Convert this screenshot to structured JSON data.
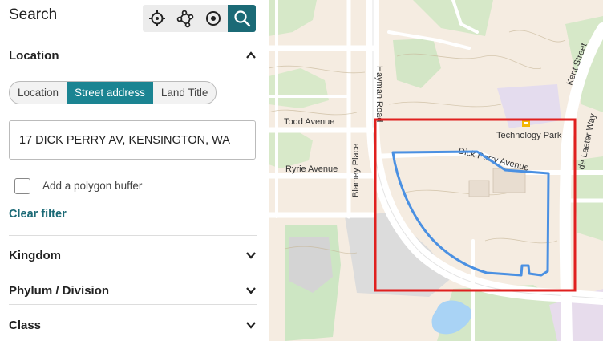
{
  "panel": {
    "title": "Search",
    "toolbar": {
      "icons": [
        "crosshair-icon",
        "polygon-draw-icon",
        "radius-icon",
        "search-icon"
      ],
      "active": "search-icon",
      "accent_color": "#1b6a76"
    },
    "location_section": {
      "label": "Location",
      "expanded": true,
      "tabs": [
        "Location",
        "Street address",
        "Land Title"
      ],
      "selected_tab": "Street address",
      "address_value": "17 DICK PERRY AV, KENSINGTON, WA",
      "buffer_label": "Add a polygon buffer",
      "buffer_checked": false,
      "clear_label": "Clear filter"
    },
    "sections": [
      {
        "label": "Kingdom",
        "expanded": false
      },
      {
        "label": "Phylum / Division",
        "expanded": false
      },
      {
        "label": "Class",
        "expanded": false
      }
    ]
  },
  "map": {
    "labels": {
      "todd": "Todd Avenue",
      "ryrie": "Ryrie Avenue",
      "blamey": "Blamey Place",
      "hayman": "Hayman Road",
      "dickperry": "Dick Perry Avenue",
      "techpark": "Technology Park",
      "kent": "Kent Street",
      "delaeter": "de Laeter Way"
    },
    "search_box_color": "#e0201f",
    "parcel_outline_color": "#4a90e2"
  }
}
